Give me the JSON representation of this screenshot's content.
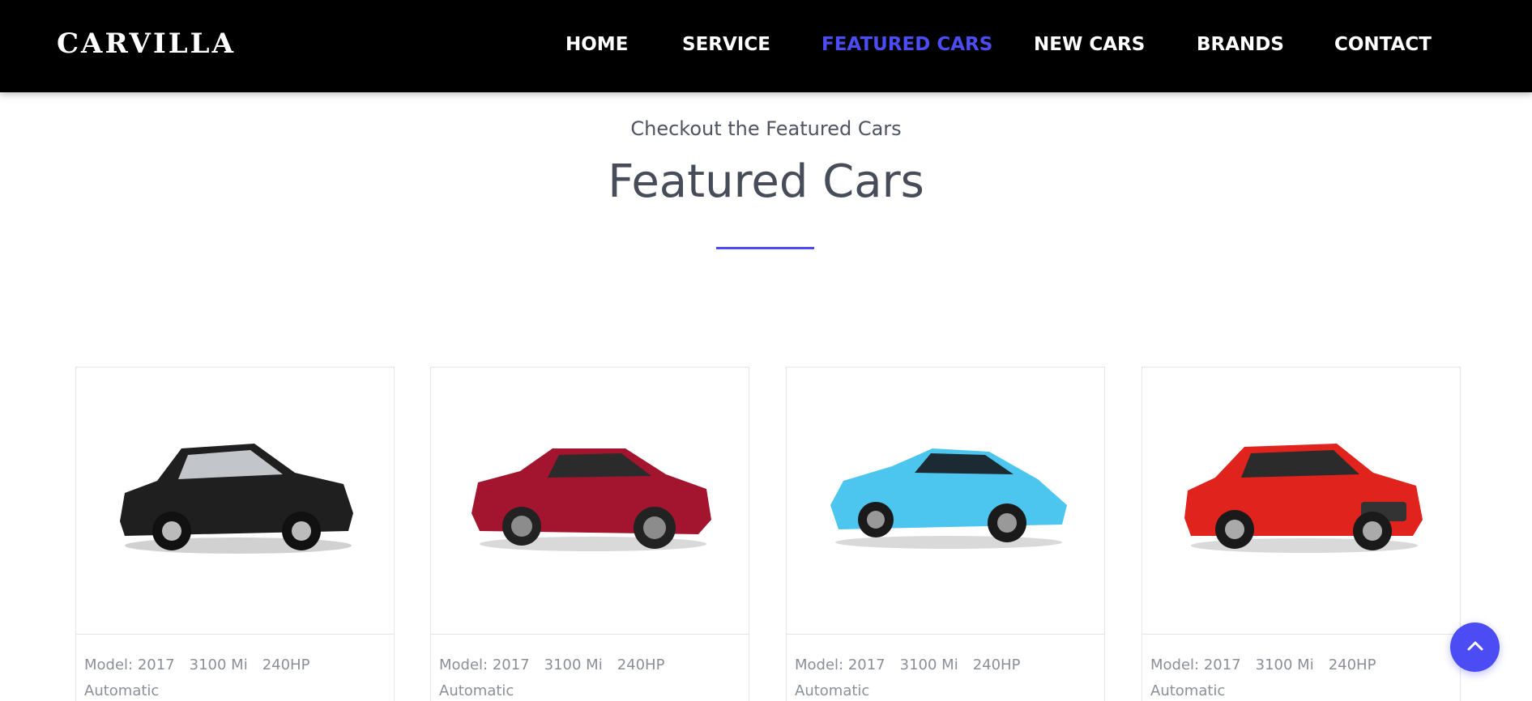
{
  "nav": {
    "logo": "CARVILLA",
    "links": [
      {
        "label": "HOME",
        "active": false
      },
      {
        "label": "SERVICE",
        "active": false
      },
      {
        "label": "FEATURED CARS",
        "active": true
      },
      {
        "label": "NEW CARS",
        "active": false
      },
      {
        "label": "BRANDS",
        "active": false
      },
      {
        "label": "CONTACT",
        "active": false
      }
    ]
  },
  "section": {
    "subtitle": "Checkout the Featured Cars",
    "title": "Featured Cars"
  },
  "cards": [
    {
      "model": "Model: 2017",
      "mileage": "3100 Mi",
      "power": "240HP",
      "transmission": "Automatic",
      "car_color": "#1f1f1f",
      "image_icon": "black-suv-icon"
    },
    {
      "model": "Model: 2017",
      "mileage": "3100 Mi",
      "power": "240HP",
      "transmission": "Automatic",
      "car_color": "#a3142e",
      "image_icon": "red-sports-coupe-icon"
    },
    {
      "model": "Model: 2017",
      "mileage": "3100 Mi",
      "power": "240HP",
      "transmission": "Automatic",
      "car_color": "#4cc6ee",
      "image_icon": "blue-supercar-icon"
    },
    {
      "model": "Model: 2017",
      "mileage": "3100 Mi",
      "power": "240HP",
      "transmission": "Automatic",
      "car_color": "#e0231c",
      "image_icon": "red-wagon-icon"
    }
  ],
  "colors": {
    "accent": "#4b4cf3",
    "navbar_bg": "#000000"
  },
  "scroll_top_icon": "chevron-up-icon"
}
